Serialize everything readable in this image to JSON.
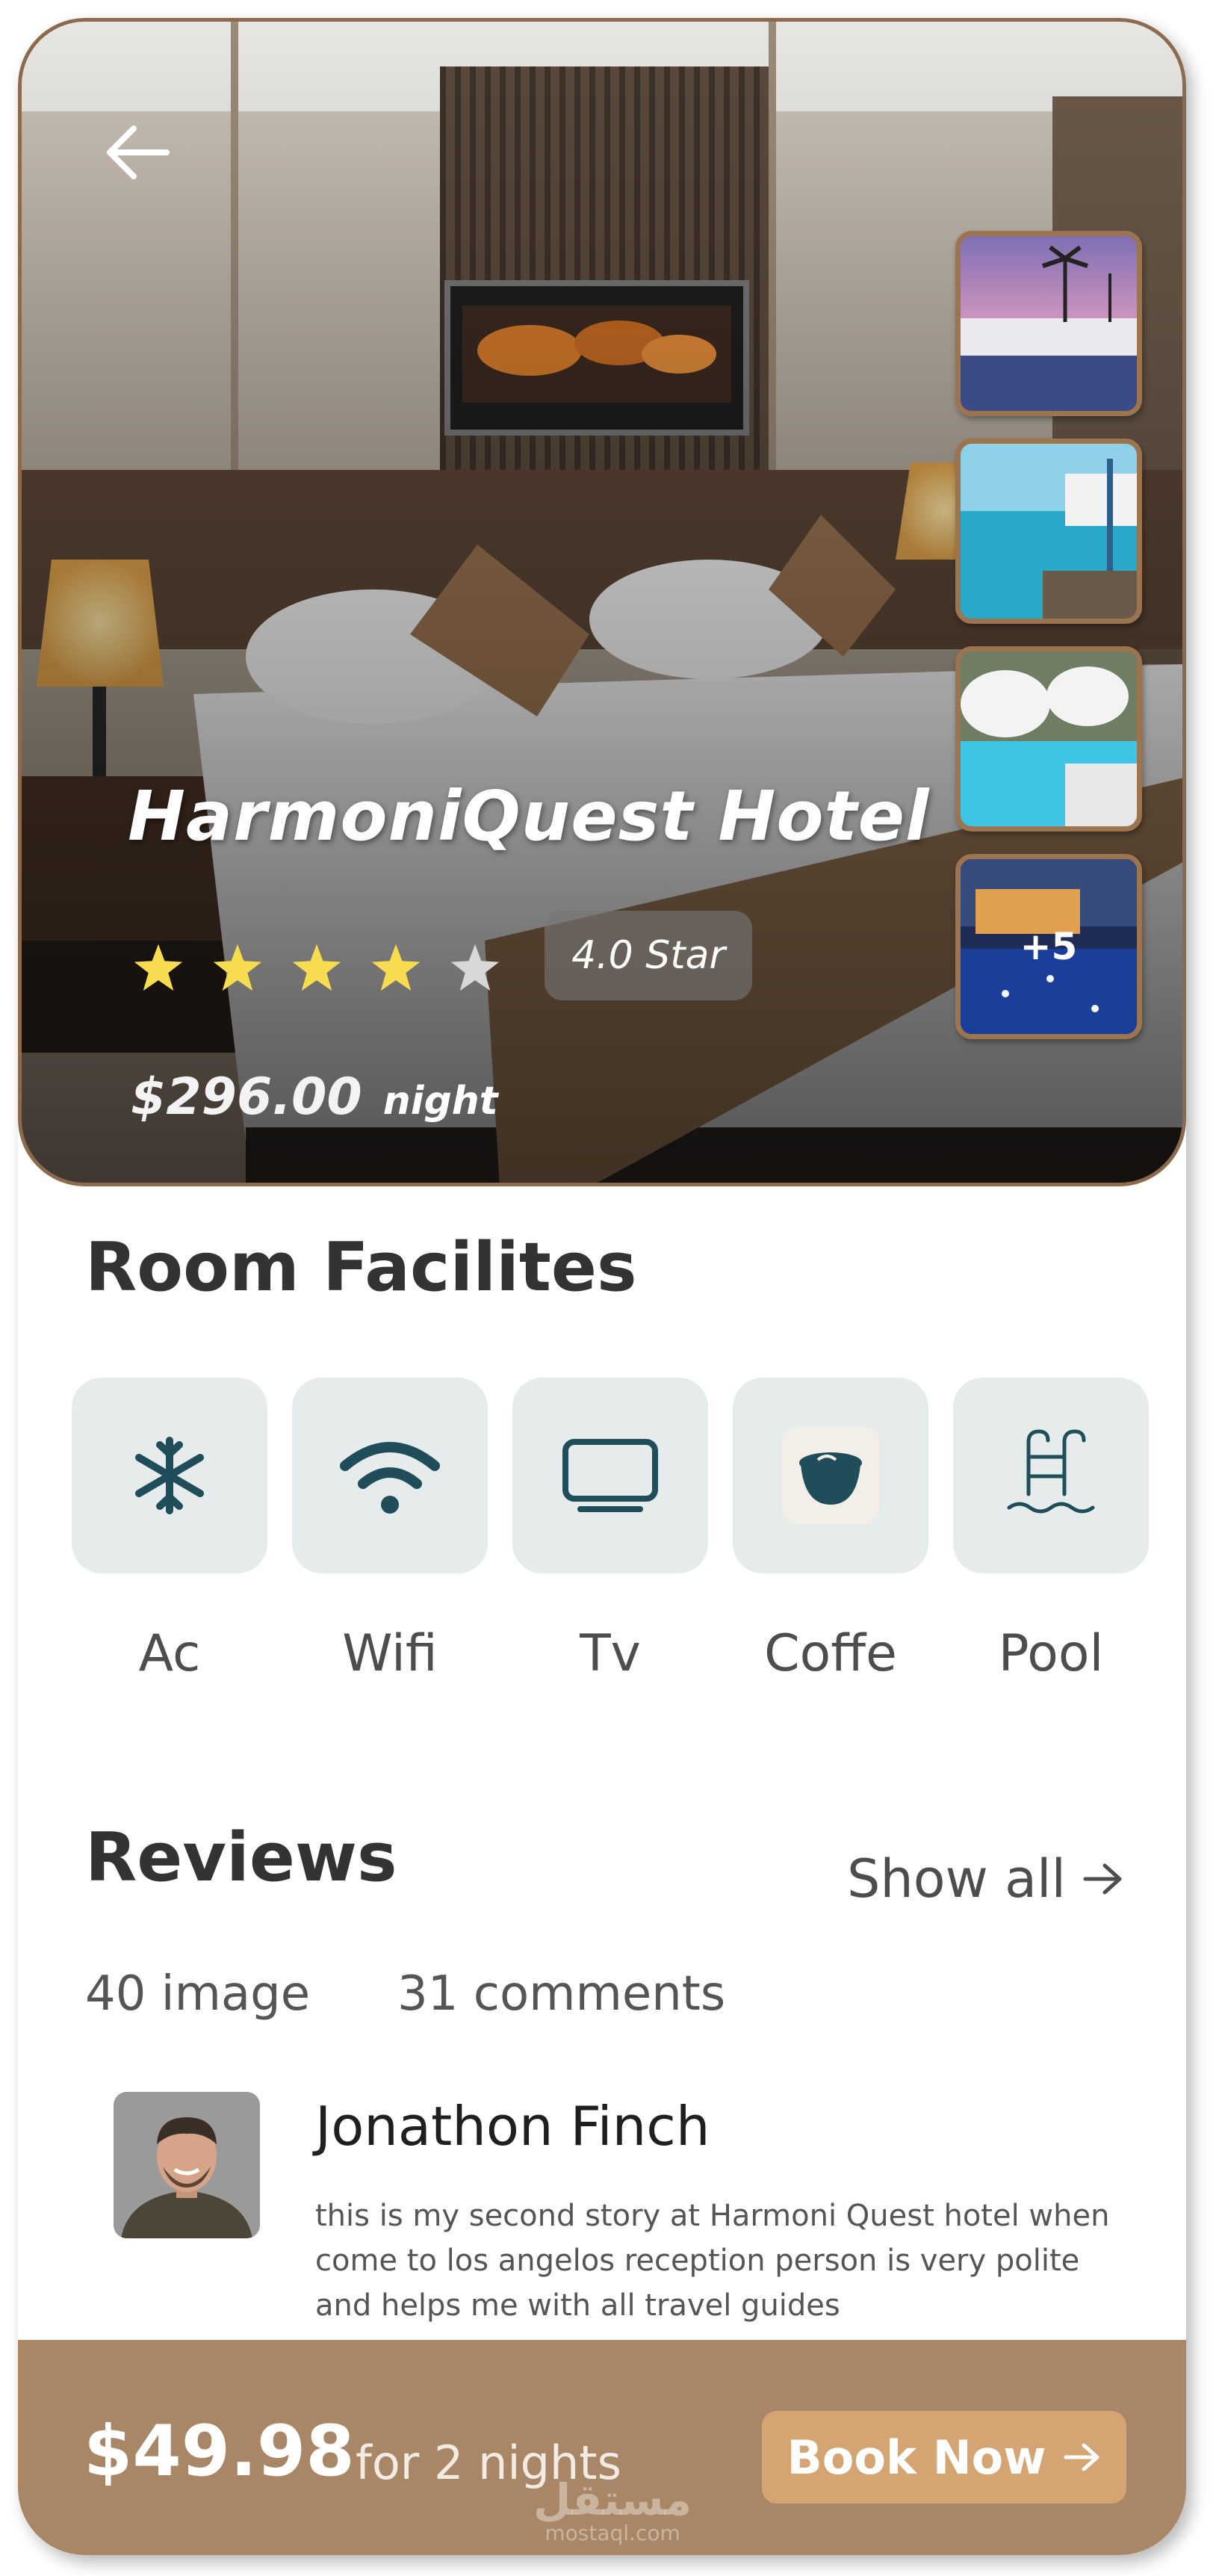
{
  "hero": {
    "hotel_name": "HarmoniQuest Hotel",
    "rating": {
      "stars_filled": 4,
      "stars_total": 5,
      "label": "4.0 Star"
    },
    "price": "$296.00",
    "price_unit": "night",
    "gallery_more": "+5",
    "back_icon": "arrow-left-icon"
  },
  "facilities": {
    "title": "Room Facilites",
    "items": [
      {
        "label": "Ac",
        "icon": "snowflake-icon"
      },
      {
        "label": "Wifi",
        "icon": "wifi-icon"
      },
      {
        "label": "Tv",
        "icon": "tv-icon"
      },
      {
        "label": "Coffe",
        "icon": "coffee-cup-icon"
      },
      {
        "label": "Pool",
        "icon": "pool-ladder-icon"
      }
    ]
  },
  "reviews": {
    "title": "Reviews",
    "show_all": "Show all",
    "image_count": "40 image",
    "comment_count": "31 comments",
    "items": [
      {
        "name": "Jonathon Finch",
        "text": "this is my second story at Harmoni Quest hotel when come to los angelos reception person is very polite and helps me with all travel guides"
      }
    ]
  },
  "booking": {
    "price": "$49.98",
    "duration": "for 2 nights",
    "button_label": "Book Now"
  },
  "watermark": {
    "arabic": "مستقل",
    "latin": "mostaql.com"
  },
  "colors": {
    "accent_brown": "#a98666",
    "button_tan": "#d4a473",
    "icon_teal": "#1f4e5a",
    "tile_bg": "#e6ecec",
    "star_yellow": "#f7dc4f"
  }
}
